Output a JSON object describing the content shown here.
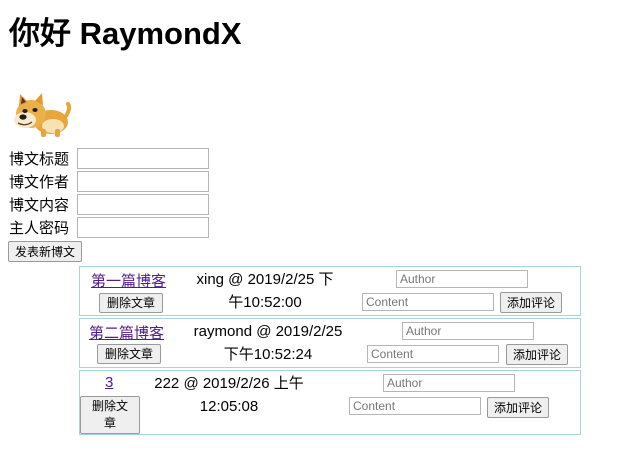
{
  "header": {
    "greeting": "你好 RaymondX"
  },
  "form": {
    "title_label": "博文标题",
    "author_label": "博文作者",
    "content_label": "博文内容",
    "password_label": "主人密码",
    "title_value": "",
    "author_value": "",
    "content_value": "",
    "password_value": "",
    "publish_label": "发表新博文"
  },
  "posts": [
    {
      "title": "第一篇博客",
      "meta_line1": "xing @ 2019/2/25 下",
      "meta_line2": "午10:52:00",
      "delete_label": "删除文章",
      "author_placeholder": "Author",
      "content_placeholder": "Content",
      "comment_label": "添加评论"
    },
    {
      "title": "第二篇博客",
      "meta_line1": "raymond @ 2019/2/25",
      "meta_line2": "下午10:52:24",
      "delete_label": "删除文章",
      "author_placeholder": "Author",
      "content_placeholder": "Content",
      "comment_label": "添加评论"
    },
    {
      "title": "3",
      "meta_line1": "222 @ 2019/2/26 上午",
      "meta_line2": "12:05:08",
      "delete_label_line1": "删除文",
      "delete_label_line2": "章",
      "author_placeholder": "Author",
      "content_placeholder": "Content",
      "comment_label": "添加评论"
    }
  ],
  "icons": {
    "avatar": "doge-avatar-icon"
  }
}
